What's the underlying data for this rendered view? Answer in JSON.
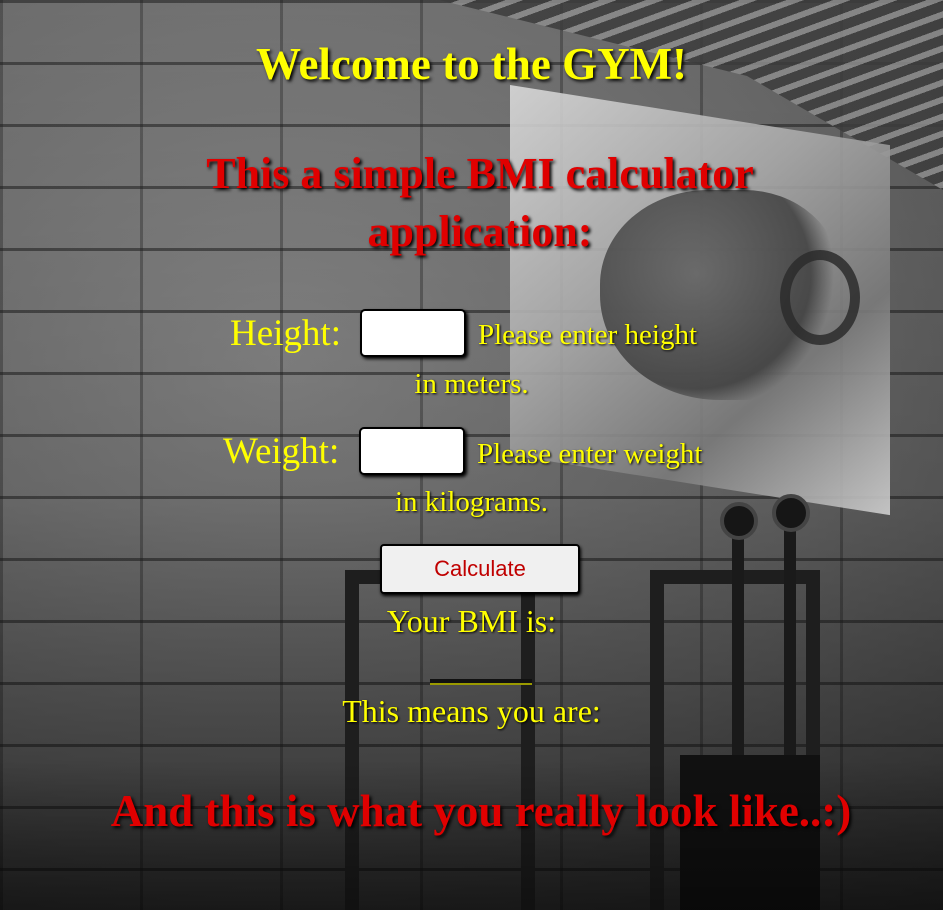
{
  "page": {
    "title": "Welcome to the GYM!",
    "subtitle": "This a simple BMI calculator application:"
  },
  "form": {
    "height": {
      "label": "Height:",
      "value": "",
      "hint_line1": "Please enter height",
      "hint_line2": "in meters."
    },
    "weight": {
      "label": "Weight:",
      "value": "",
      "hint_line1": "Please enter weight",
      "hint_line2": "in kilograms."
    },
    "calculate_label": "Calculate"
  },
  "result": {
    "bmi_label": "Your BMI is:",
    "bmi_value": "",
    "means_label": "This means you are:",
    "category": ""
  },
  "footer": {
    "look_like_text": "And this is what you really look like..:)"
  },
  "colors": {
    "heading_yellow": "#ffff00",
    "heading_red": "#e00000",
    "button_text": "#c00000"
  }
}
